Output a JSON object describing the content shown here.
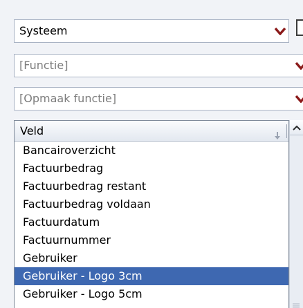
{
  "system_select": {
    "value": "Systeem"
  },
  "function_select": {
    "placeholder": "[Functie]"
  },
  "format_select": {
    "placeholder": "[Opmaak functie]"
  },
  "field_list": {
    "header": "Veld",
    "items": [
      {
        "label": "Bancairoverzicht",
        "selected": false
      },
      {
        "label": "Factuurbedrag",
        "selected": false
      },
      {
        "label": "Factuurbedrag restant",
        "selected": false
      },
      {
        "label": "Factuurbedrag voldaan",
        "selected": false
      },
      {
        "label": "Factuurdatum",
        "selected": false
      },
      {
        "label": "Factuurnummer",
        "selected": false
      },
      {
        "label": "Gebruiker",
        "selected": false
      },
      {
        "label": "Gebruiker - Logo 3cm",
        "selected": true
      },
      {
        "label": "Gebruiker - Logo 5cm",
        "selected": false
      }
    ]
  },
  "colors": {
    "selection": "#3e68b1",
    "dropdown_arrow": "#8b1a1a",
    "border": "#a9b3c4"
  },
  "icons": {
    "dropdown": "chevron-down-icon",
    "sort": "sort-down-arrow-icon",
    "scroll_up": "scroll-up-arrow-icon"
  }
}
